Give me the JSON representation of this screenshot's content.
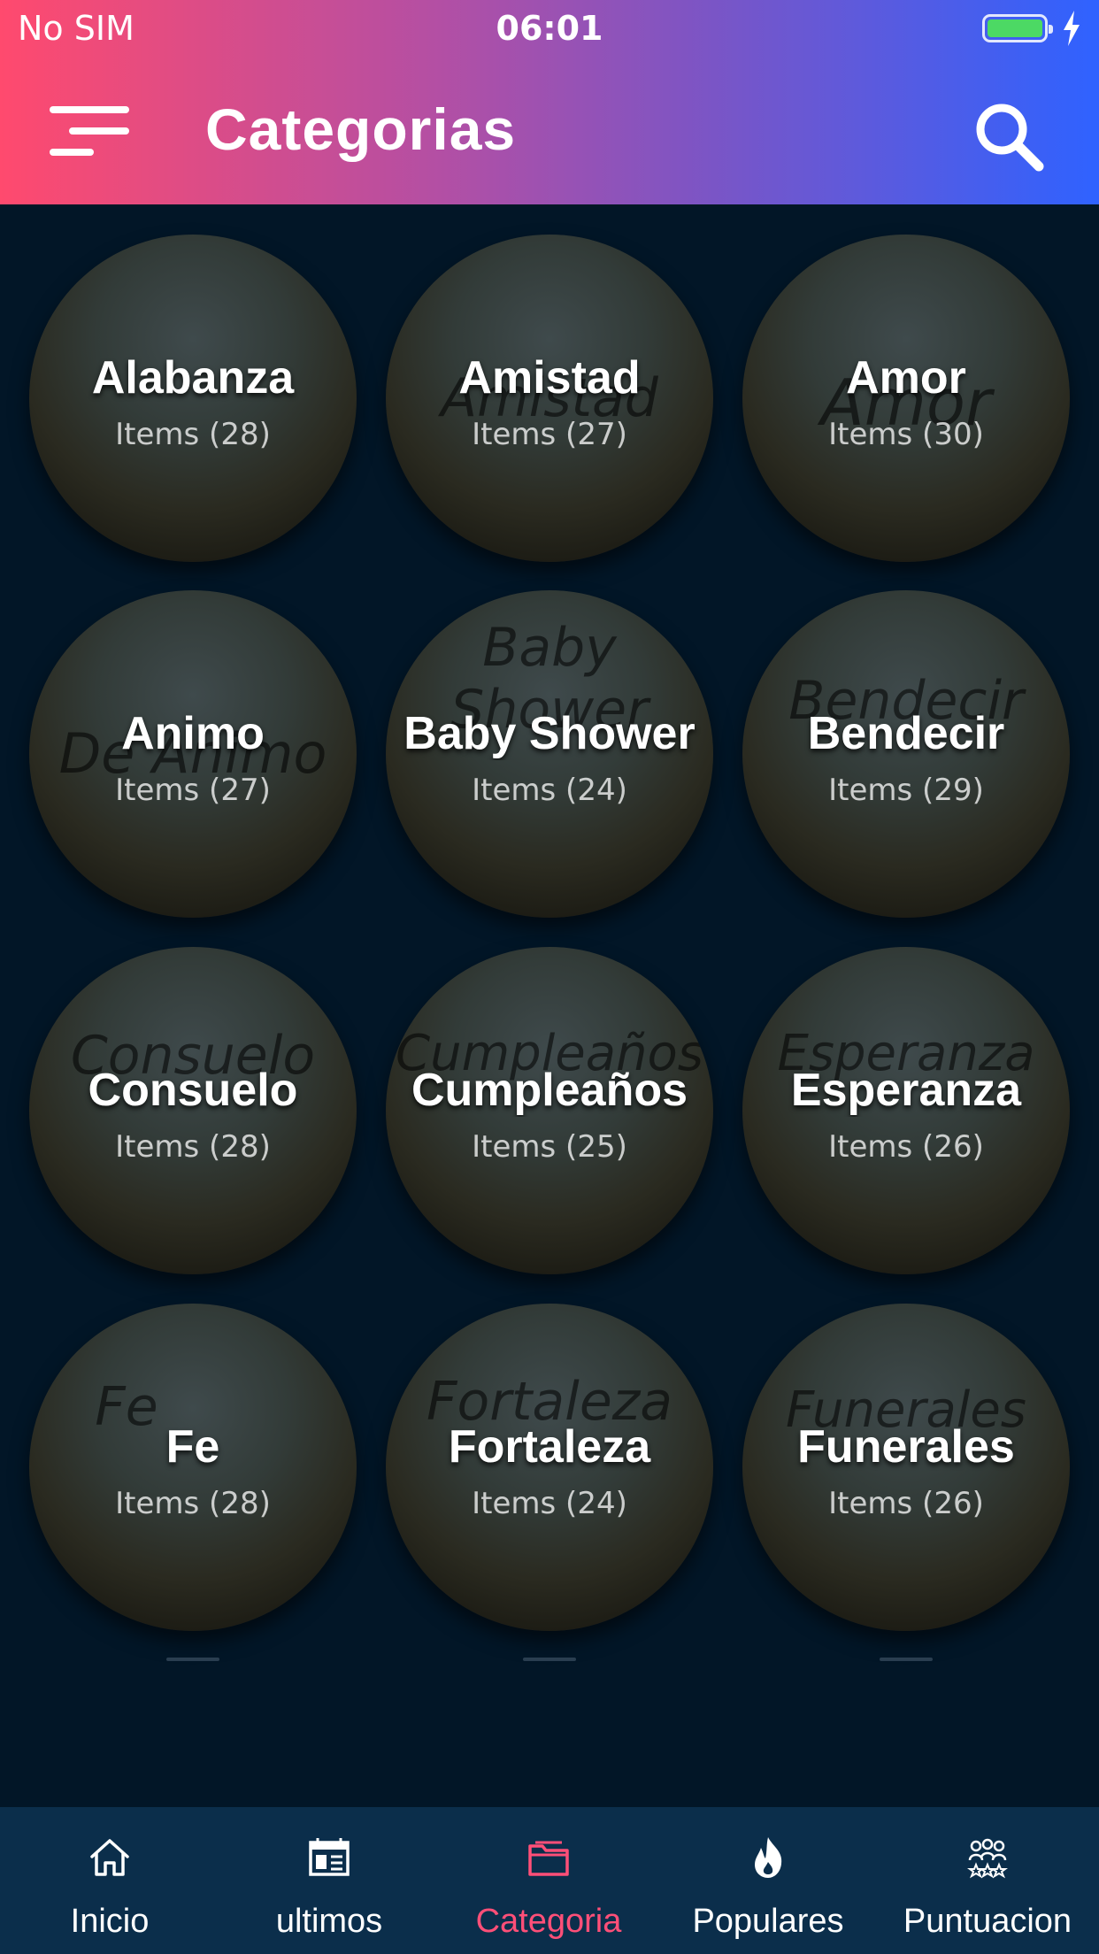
{
  "status_bar": {
    "carrier": "No SIM",
    "time": "06:01",
    "battery_color": "#4cd964"
  },
  "header": {
    "title": "Categorias",
    "menu_icon": "hamburger-menu-icon",
    "search_icon": "search-icon",
    "gradient_start": "#ff4a6e",
    "gradient_end": "#2f62ff"
  },
  "categories": [
    {
      "name": "Alabanza",
      "count": "Items (28)",
      "watermark": ""
    },
    {
      "name": "Amistad",
      "count": "Items (27)",
      "watermark": "Amistad"
    },
    {
      "name": "Amor",
      "count": "Items (30)",
      "watermark": "Amor"
    },
    {
      "name": "Animo",
      "count": "Items (27)",
      "watermark": "De Animo"
    },
    {
      "name": "Baby Shower",
      "count": "Items (24)",
      "watermark": "Baby Shower"
    },
    {
      "name": "Bendecir",
      "count": "Items (29)",
      "watermark": "Bendecir"
    },
    {
      "name": "Consuelo",
      "count": "Items (28)",
      "watermark": "Consuelo"
    },
    {
      "name": "Cumpleaños",
      "count": "Items (25)",
      "watermark": "Cumpleaños"
    },
    {
      "name": "Esperanza",
      "count": "Items (26)",
      "watermark": "Esperanza"
    },
    {
      "name": "Fe",
      "count": "Items (28)",
      "watermark": "Fe"
    },
    {
      "name": "Fortaleza",
      "count": "Items (24)",
      "watermark": "Fortaleza"
    },
    {
      "name": "Funerales",
      "count": "Items (26)",
      "watermark": "Funerales"
    }
  ],
  "bottom_nav": {
    "active_color": "#ff4f78",
    "items": [
      {
        "label": "Inicio",
        "icon": "home-icon"
      },
      {
        "label": "ultimos",
        "icon": "calendar-icon"
      },
      {
        "label": "Categoria",
        "icon": "folder-icon",
        "active": true
      },
      {
        "label": "Populares",
        "icon": "fire-icon"
      },
      {
        "label": "Puntuacion",
        "icon": "users-star-icon"
      }
    ]
  }
}
